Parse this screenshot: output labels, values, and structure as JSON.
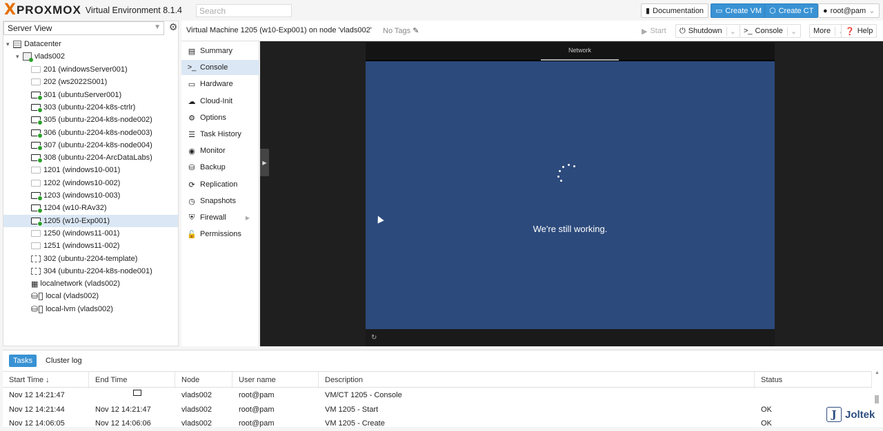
{
  "header": {
    "logo_x": "X",
    "brand": "PROXMOX",
    "version": "Virtual Environment 8.1.4",
    "search_placeholder": "Search",
    "documentation": "Documentation",
    "create_vm": "Create VM",
    "create_ct": "Create CT",
    "user": "root@pam"
  },
  "tree": {
    "view": "Server View",
    "datacenter": "Datacenter",
    "node": "vlads002",
    "items": [
      {
        "label": "201 (windowsServer001)",
        "state": "off"
      },
      {
        "label": "202 (ws2022S001)",
        "state": "off"
      },
      {
        "label": "301 (ubuntuServer001)",
        "state": "run"
      },
      {
        "label": "303 (ubuntu-2204-k8s-ctrlr)",
        "state": "run"
      },
      {
        "label": "305 (ubuntu-2204-k8s-node002)",
        "state": "run"
      },
      {
        "label": "306 (ubuntu-2204-k8s-node003)",
        "state": "run"
      },
      {
        "label": "307 (ubuntu-2204-k8s-node004)",
        "state": "run"
      },
      {
        "label": "308 (ubuntu-2204-ArcDataLabs)",
        "state": "run"
      },
      {
        "label": "1201 (windows10-001)",
        "state": "off"
      },
      {
        "label": "1202 (windows10-002)",
        "state": "off"
      },
      {
        "label": "1203 (windows10-003)",
        "state": "run"
      },
      {
        "label": "1204 (w10-RAv32)",
        "state": "run"
      },
      {
        "label": "1205 (w10-Exp001)",
        "state": "run",
        "selected": true
      },
      {
        "label": "1250 (windows11-001)",
        "state": "off"
      },
      {
        "label": "1251 (windows11-002)",
        "state": "off"
      },
      {
        "label": "302 (ubuntu-2204-template)",
        "state": "tpl"
      },
      {
        "label": "304 (ubuntu-2204-k8s-node001)",
        "state": "tpl"
      },
      {
        "label": "localnetwork (vlads002)",
        "state": "net"
      },
      {
        "label": "local (vlads002)",
        "state": "storage"
      },
      {
        "label": "local-lvm (vlads002)",
        "state": "storage"
      }
    ]
  },
  "vmbar": {
    "title": "Virtual Machine 1205 (w10-Exp001) on node 'vlads002'",
    "tags": "No Tags",
    "start": "Start",
    "shutdown": "Shutdown",
    "console": "Console",
    "more": "More",
    "help": "Help"
  },
  "menu": [
    {
      "label": "Summary",
      "icon": "▤"
    },
    {
      "label": "Console",
      "icon": ">_",
      "selected": true
    },
    {
      "label": "Hardware",
      "icon": "▭"
    },
    {
      "label": "Cloud-Init",
      "icon": "☁"
    },
    {
      "label": "Options",
      "icon": "⚙"
    },
    {
      "label": "Task History",
      "icon": "☰"
    },
    {
      "label": "Monitor",
      "icon": "◉"
    },
    {
      "label": "Backup",
      "icon": "⛁"
    },
    {
      "label": "Replication",
      "icon": "⟳"
    },
    {
      "label": "Snapshots",
      "icon": "◷"
    },
    {
      "label": "Firewall",
      "icon": "⛨",
      "submenu": true
    },
    {
      "label": "Permissions",
      "icon": "🔓"
    }
  ],
  "console": {
    "tab": "Network",
    "message": "We're still working."
  },
  "tasks": {
    "tab_tasks": "Tasks",
    "tab_cluster": "Cluster log",
    "columns": [
      "Start Time ↓",
      "End Time",
      "Node",
      "User name",
      "Description",
      "Status"
    ],
    "rows": [
      {
        "start": "Nov 12 14:21:47",
        "end": "",
        "node": "vlads002",
        "user": "root@pam",
        "desc": "VM/CT 1205 - Console",
        "status": ""
      },
      {
        "start": "Nov 12 14:21:44",
        "end": "Nov 12 14:21:47",
        "node": "vlads002",
        "user": "root@pam",
        "desc": "VM 1205 - Start",
        "status": "OK"
      },
      {
        "start": "Nov 12 14:06:05",
        "end": "Nov 12 14:06:06",
        "node": "vlads002",
        "user": "root@pam",
        "desc": "VM 1205 - Create",
        "status": "OK"
      }
    ]
  },
  "watermark": {
    "letter": "J",
    "text": "Joltek"
  }
}
